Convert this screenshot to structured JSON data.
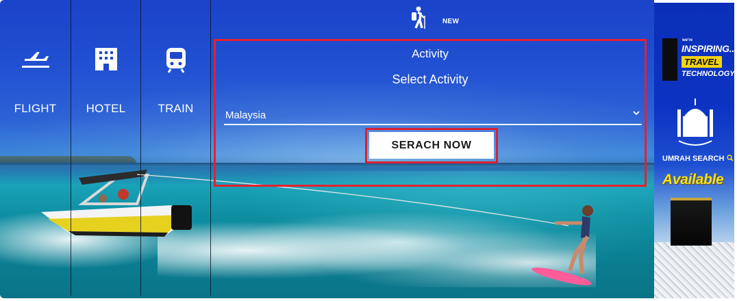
{
  "tabs": [
    {
      "label": "FLIGHT",
      "icon": "plane-icon"
    },
    {
      "label": "HOTEL",
      "icon": "building-icon"
    },
    {
      "label": "TRAIN",
      "icon": "train-icon"
    }
  ],
  "activity": {
    "icon": "hiking-icon",
    "badge": "NEW",
    "title": "Activity",
    "subtitle": "Select Activity",
    "selected_country": "Malaysia",
    "search_label": "SERACH NOW"
  },
  "ad": {
    "tagline_small": "we're",
    "line1": "INSPIRING...",
    "line2": "TRAVEL",
    "line3": "TECHNOLOGY",
    "umrah": "UMRAH SEARCH",
    "available": "Available"
  },
  "colors": {
    "highlight_red": "#e5202e",
    "sky_blue": "#2150d2",
    "ad_yellow": "#f6e01d"
  }
}
